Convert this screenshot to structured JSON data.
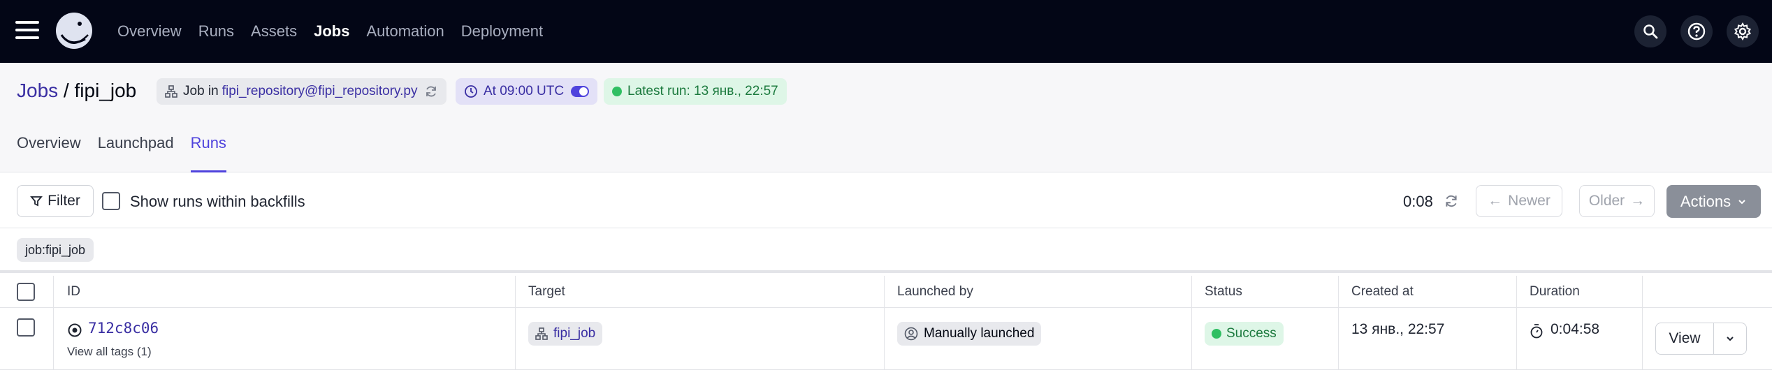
{
  "nav": {
    "links": [
      "Overview",
      "Runs",
      "Assets",
      "Jobs",
      "Automation",
      "Deployment"
    ],
    "active": "Jobs",
    "icons": [
      "search-icon",
      "help-icon",
      "settings-icon"
    ]
  },
  "header": {
    "breadcrumb_parent": "Jobs",
    "separator": " / ",
    "job_name": "fipi_job",
    "job_tag_prefix": "Job in",
    "job_tag_repo": "fipi_repository@fipi_repository.py",
    "schedule": "At 09:00 UTC",
    "latest_run": "Latest run: 13 янв., 22:57",
    "tabs": [
      "Overview",
      "Launchpad",
      "Runs"
    ],
    "active_tab": "Runs"
  },
  "toolbar": {
    "filter_label": "Filter",
    "backfills_label": "Show runs within backfills",
    "refresh_timer": "0:08",
    "newer_label": "Newer",
    "older_label": "Older",
    "actions_label": "Actions"
  },
  "filter_tag": "job:fipi_job",
  "table": {
    "columns": [
      "ID",
      "Target",
      "Launched by",
      "Status",
      "Created at",
      "Duration"
    ],
    "rows": [
      {
        "id": "712c8c06",
        "view_tags": "View all tags (1)",
        "target": "fipi_job",
        "launched_by": "Manually launched",
        "status": "Success",
        "created_at": "13 янв., 22:57",
        "duration": "0:04:58",
        "view_label": "View"
      }
    ]
  },
  "colors": {
    "nav_bg": "#030616",
    "accent": "#4f43dd",
    "link": "#3a2fa3",
    "success_bg": "#def6e7",
    "success_text": "#1c7a3e",
    "success_dot": "#2fbf62"
  }
}
